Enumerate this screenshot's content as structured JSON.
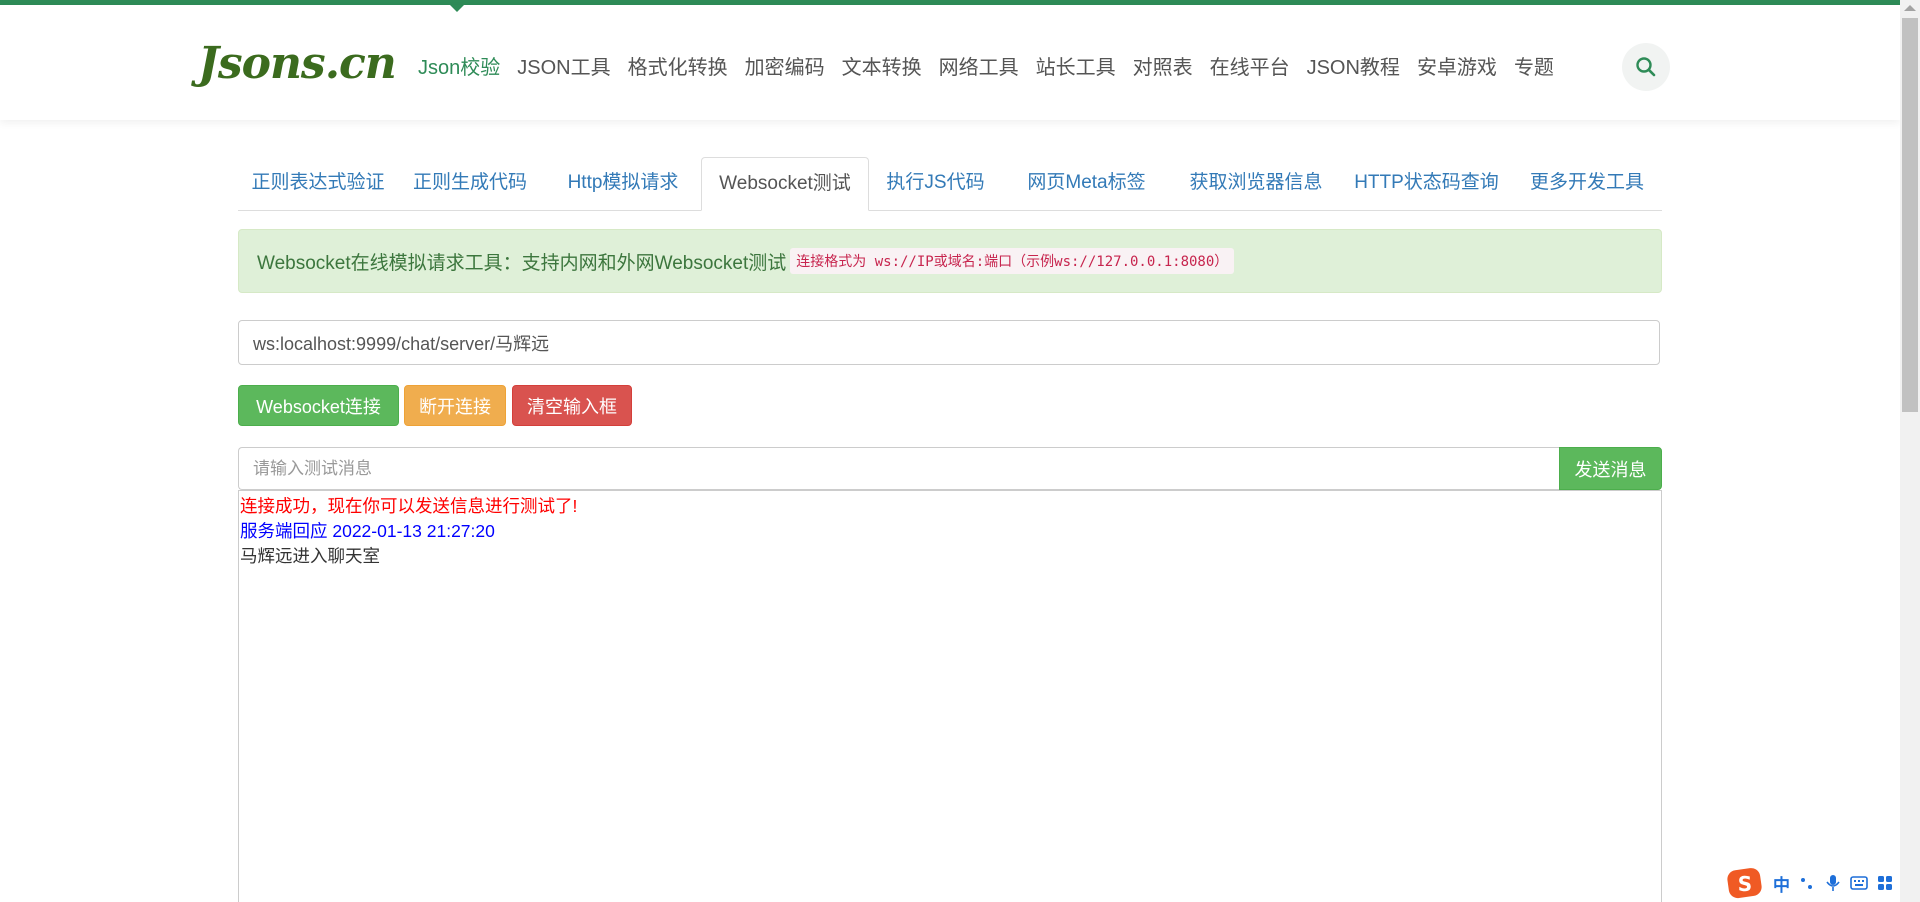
{
  "header": {
    "logo": "Jsons.cn",
    "nav": [
      "Json校验",
      "JSON工具",
      "格式化转换",
      "加密编码",
      "文本转换",
      "网络工具",
      "站长工具",
      "对照表",
      "在线平台",
      "JSON教程",
      "安卓游戏",
      "专题"
    ],
    "active_nav": "Json校验"
  },
  "tabs": [
    "正则表达式验证",
    "正则生成代码",
    "Http模拟请求",
    "Websocket测试",
    "执行JS代码",
    "网页Meta标签",
    "获取浏览器信息",
    "HTTP状态码查询",
    "更多开发工具"
  ],
  "active_tab": "Websocket测试",
  "alert": {
    "text": "Websocket在线模拟请求工具：支持内网和外网Websocket测试",
    "code": "连接格式为 ws://IP或域名:端口（示例ws://127.0.0.1:8080）"
  },
  "url_input": {
    "value": "ws:localhost:9999/chat/server/马辉远"
  },
  "buttons": {
    "connect": "Websocket连接",
    "disconnect": "断开连接",
    "clear": "清空输入框",
    "send": "发送消息"
  },
  "message_input": {
    "placeholder": "请输入测试消息",
    "value": ""
  },
  "output": {
    "success": "连接成功，现在你可以发送信息进行测试了!",
    "server_echo": "服务端回应 2022-01-13 21:27:20",
    "message": "马辉远进入聊天室"
  },
  "ime": {
    "mode": "中"
  },
  "colors": {
    "brand_green": "#2e8b57",
    "success_btn": "#5cb85c",
    "warning_btn": "#f0ad4e",
    "danger_btn": "#d9534f",
    "link_blue": "#337ab7"
  }
}
